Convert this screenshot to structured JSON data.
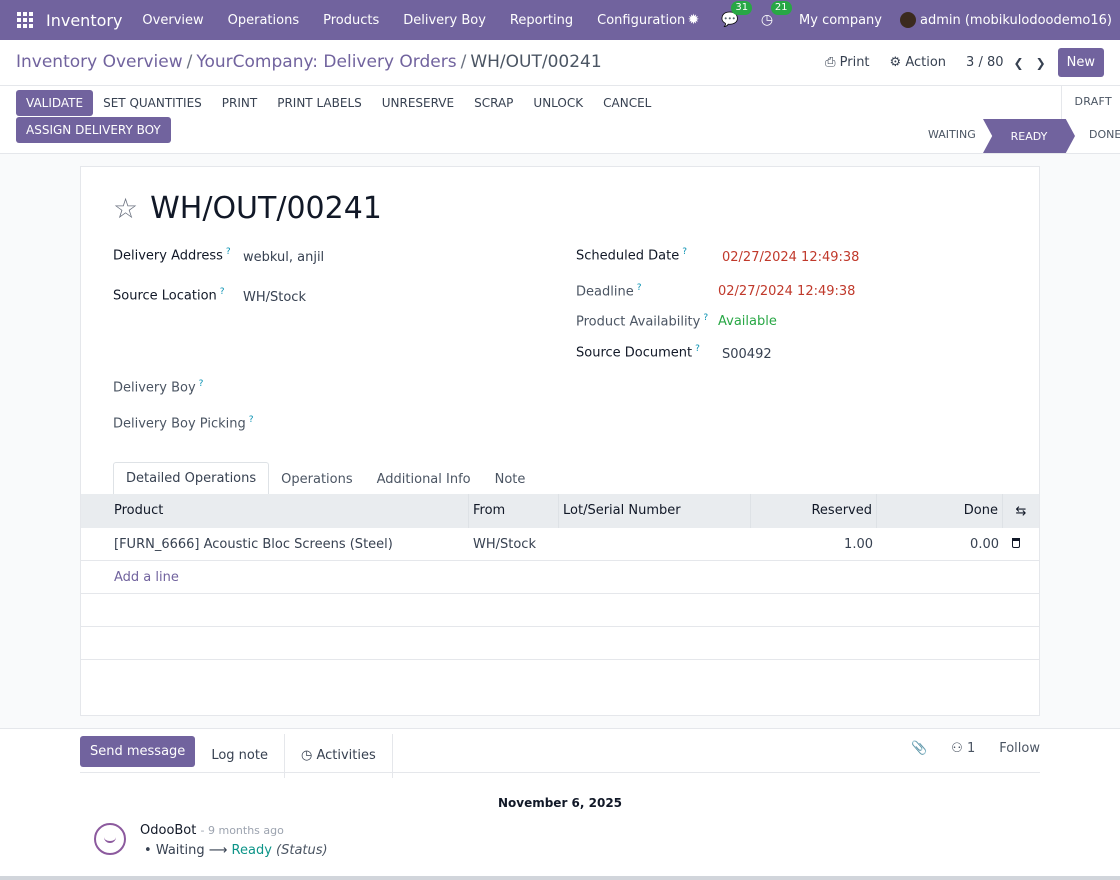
{
  "navbar": {
    "brand": "Inventory",
    "menu": [
      "Overview",
      "Operations",
      "Products",
      "Delivery Boy",
      "Reporting",
      "Configuration"
    ],
    "messages_badge": "31",
    "activities_badge": "21",
    "company": "My company",
    "user": "admin (mobikulodoodemo16)"
  },
  "control_panel": {
    "breadcrumb": [
      "Inventory Overview",
      "YourCompany: Delivery Orders",
      "WH/OUT/00241"
    ],
    "print_label": "Print",
    "action_label": "Action",
    "pager": "3 / 80",
    "new_label": "New"
  },
  "status_bar": {
    "buttons": [
      "VALIDATE",
      "SET QUANTITIES",
      "PRINT",
      "PRINT LABELS",
      "UNRESERVE",
      "SCRAP",
      "UNLOCK",
      "CANCEL"
    ],
    "assign_label": "ASSIGN DELIVERY BOY",
    "stages": {
      "draft": "DRAFT",
      "waiting": "WAITING",
      "ready": "READY",
      "done": "DONE"
    }
  },
  "form": {
    "title": "WH/OUT/00241",
    "delivery_address_label": "Delivery Address",
    "delivery_address": "webkul, anjil",
    "source_location_label": "Source Location",
    "source_location": "WH/Stock",
    "delivery_boy_label": "Delivery Boy",
    "delivery_boy_picking_label": "Delivery Boy Picking",
    "scheduled_date_label": "Scheduled Date",
    "scheduled_date": "02/27/2024 12:49:38",
    "deadline_label": "Deadline",
    "deadline": "02/27/2024 12:49:38",
    "availability_label": "Product Availability",
    "availability": "Available",
    "source_document_label": "Source Document",
    "source_document": "S00492",
    "help_mark": "?"
  },
  "tabs": [
    "Detailed Operations",
    "Operations",
    "Additional Info",
    "Note"
  ],
  "table": {
    "columns": [
      "Product",
      "From",
      "Lot/Serial Number",
      "Reserved",
      "Done"
    ],
    "rows": [
      {
        "product": "[FURN_6666] Acoustic Bloc Screens (Steel)",
        "from": "WH/Stock",
        "lot": "",
        "reserved": "1.00",
        "done": "0.00"
      }
    ],
    "add_line": "Add a line"
  },
  "chatter": {
    "send_message": "Send message",
    "log_note": "Log note",
    "activities": "Activities",
    "followers_count": "1",
    "follow": "Follow",
    "date": "November 6, 2025",
    "message": {
      "author": "OdooBot",
      "time": "- 9 months ago",
      "from_status": "Waiting",
      "to_status": "Ready",
      "field": "(Status)"
    }
  }
}
